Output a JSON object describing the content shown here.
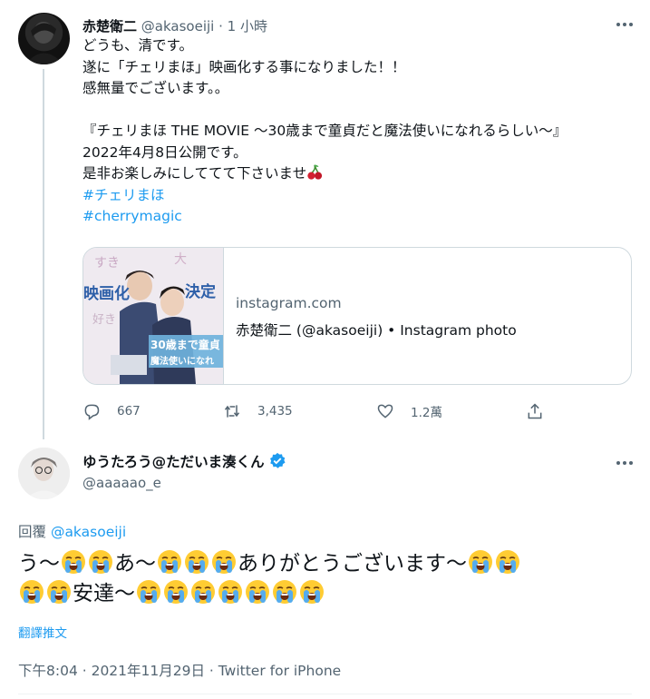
{
  "colors": {
    "accent": "#1d9bf0",
    "muted": "#536471",
    "text": "#0f1419",
    "border": "#cfd9de"
  },
  "parent": {
    "display_name": "赤楚衛二",
    "handle": "@akasoeiji",
    "dot": "·",
    "time": "1 小時",
    "lines": [
      "どうも、清です。",
      "遂に「チェリまほ」映画化する事になりました！！",
      "感無量でございます。。",
      "",
      "『チェリまほ THE MOVIE ～30歳まで童貞だと魔法使いになれるらしい～』",
      "2022年4月8日公開です。",
      "是非お楽しみにしててて下さいませ"
    ],
    "hashtags": [
      "#チェリまほ",
      "#cherrymagic"
    ],
    "card": {
      "domain": "instagram.com",
      "title": "赤楚衛二 (@akasoeiji) • Instagram photo",
      "image_texts": [
        "映画化",
        "決定",
        "30歳まで童貞",
        "魔法使いになれ",
        "すき",
        "好き",
        "大"
      ]
    },
    "actions": {
      "replies": "667",
      "retweets": "3,435",
      "likes": "1.2萬"
    }
  },
  "reply": {
    "display_name": "ゆうたろう@ただいま湊くん",
    "handle": "@aaaaao_e",
    "replying_prefix": "回覆 ",
    "replying_to": "@akasoeiji",
    "text_parts_line1": [
      "う～",
      "E",
      "E",
      "あ～",
      "E",
      "E",
      "E",
      "ありがとうございます～",
      "E",
      "E"
    ],
    "text_parts_line2": [
      "E",
      "E",
      "安達～",
      "E",
      "E",
      "E",
      "E",
      "E",
      "E",
      "E"
    ],
    "translate": "翻譯推文",
    "timestamp": "下午8:04 · 2021年11月29日 · Twitter for iPhone"
  }
}
